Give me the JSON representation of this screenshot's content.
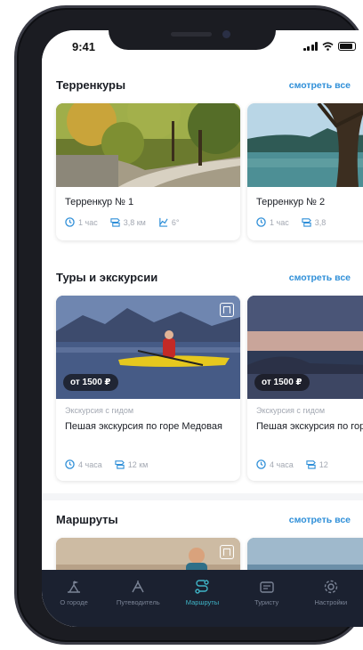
{
  "status_bar": {
    "time": "9:41"
  },
  "sections": [
    {
      "title": "Терренкуры",
      "see_all": "смотреть все",
      "cards": [
        {
          "title": "Терренкур № 1",
          "duration": "1 час",
          "distance": "3,8 км",
          "elevation": "6°"
        },
        {
          "title": "Терренкур № 2",
          "duration": "1 час",
          "distance": "3,8"
        }
      ]
    },
    {
      "title": "Туры и экскурсии",
      "see_all": "смотреть все",
      "cards": [
        {
          "price": "от 1500 ₽",
          "category": "Экскурсия с гидом",
          "title": "Пешая экскурсия по горе Медовая",
          "duration": "4 часа",
          "distance": "12 км"
        },
        {
          "price": "от 1500 ₽",
          "category": "Экскурсия с гидом",
          "title": "Пешая экскурсия по горе Медовая",
          "duration": "4 часа",
          "distance": "12"
        }
      ]
    },
    {
      "title": "Маршруты",
      "see_all": "смотреть все"
    }
  ],
  "tabbar": {
    "items": [
      {
        "label": "О городе",
        "icon": "city-icon"
      },
      {
        "label": "Путеводитель",
        "icon": "guide-icon"
      },
      {
        "label": "Маршруты",
        "icon": "routes-icon",
        "active": true
      },
      {
        "label": "Туристу",
        "icon": "tourist-icon"
      },
      {
        "label": "Настройки",
        "icon": "settings-icon"
      }
    ]
  },
  "colors": {
    "accent": "#2f8fd8",
    "tab_active": "#3fb5c7",
    "tabbar_bg": "#1b2130"
  }
}
